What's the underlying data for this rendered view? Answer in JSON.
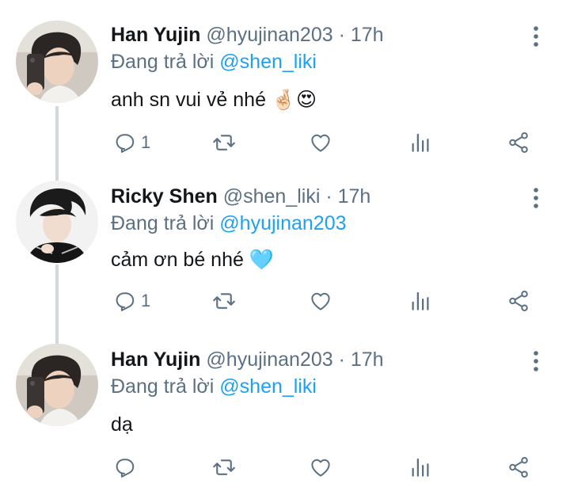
{
  "colors": {
    "accent": "#1da1f2",
    "muted": "#5b7083",
    "text": "#14171a",
    "thread_line": "#cfd9de"
  },
  "tweets": [
    {
      "name": "Han Yujin",
      "handle": "@hyujinan203",
      "separator": "·",
      "time": "17h",
      "reply_prefix": "Đang trả lời ",
      "reply_to": "@shen_liki",
      "text": "anh sn vui vẻ nhé 🤞🏻😍",
      "reply_count": "1",
      "icons": [
        "reply-icon",
        "retweet-icon",
        "like-icon",
        "stats-icon",
        "share-icon",
        "more-icon"
      ]
    },
    {
      "name": "Ricky Shen",
      "handle": "@shen_liki",
      "separator": "·",
      "time": "17h",
      "reply_prefix": "Đang trả lời ",
      "reply_to": "@hyujinan203",
      "text": "cảm ơn bé nhé 🩵",
      "reply_count": "1",
      "icons": [
        "reply-icon",
        "retweet-icon",
        "like-icon",
        "stats-icon",
        "share-icon",
        "more-icon"
      ]
    },
    {
      "name": "Han Yujin",
      "handle": "@hyujinan203",
      "separator": "·",
      "time": "17h",
      "reply_prefix": "Đang trả lời ",
      "reply_to": "@shen_liki",
      "text": "dạ",
      "reply_count": "",
      "icons": [
        "reply-icon",
        "retweet-icon",
        "like-icon",
        "stats-icon",
        "share-icon",
        "more-icon"
      ]
    }
  ]
}
